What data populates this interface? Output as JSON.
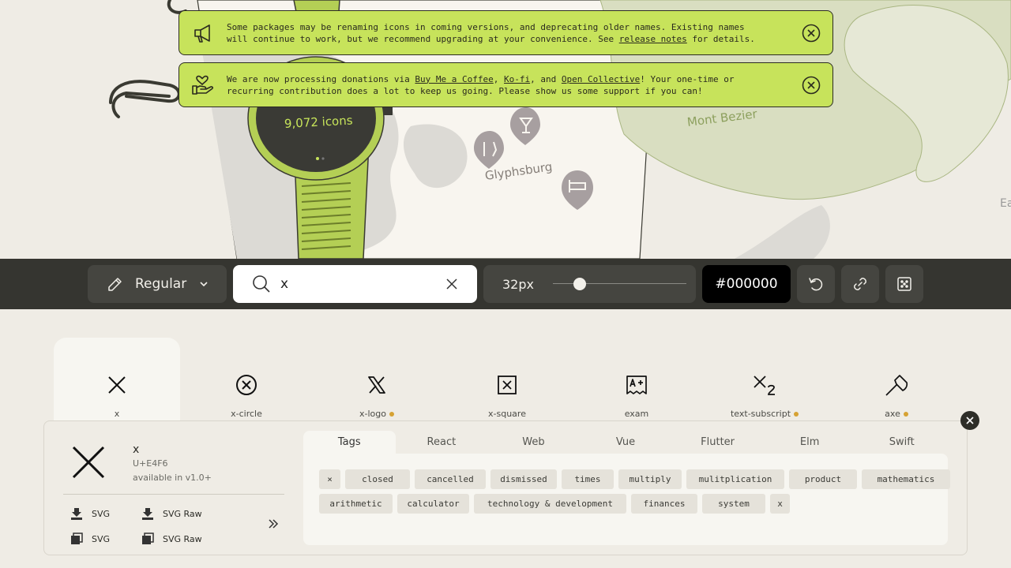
{
  "hero": {
    "watch_count": "9,072 icons",
    "map_labels": {
      "town": "Glyphsburg",
      "mountain": "Mont Bezier",
      "edge": "Ea"
    }
  },
  "notices": [
    {
      "icon": "megaphone-icon",
      "text_before": "Some packages may be renaming icons in coming versions, and deprecating older names. Existing names\nwill continue to work, but we recommend upgrading at your convenience. See ",
      "link": "release notes",
      "text_after": " for details."
    },
    {
      "icon": "hand-heart-icon",
      "text_1": "We are now processing donations via ",
      "link_1": "Buy Me a Coffee",
      "sep_1": ", ",
      "link_2": "Ko-fi",
      "sep_2": ", and ",
      "link_3": "Open Collective",
      "text_2": "! Your one-time or\nrecurring contribution does a lot to keep us going. Please show us some support if you can!"
    }
  ],
  "toolbar": {
    "weight": "Regular",
    "search": {
      "value": "x",
      "placeholder": ""
    },
    "size": {
      "label": "32px",
      "value": 32,
      "min": 16,
      "max": 96
    },
    "color": "#000000"
  },
  "grid": [
    {
      "name": "x",
      "icon": "x-icon",
      "selected": true,
      "badge": false
    },
    {
      "name": "x-circle",
      "icon": "x-circle-icon",
      "selected": false,
      "badge": false
    },
    {
      "name": "x-logo",
      "icon": "x-logo-icon",
      "selected": false,
      "badge": true
    },
    {
      "name": "x-square",
      "icon": "x-square-icon",
      "selected": false,
      "badge": false
    },
    {
      "name": "exam",
      "icon": "exam-icon",
      "selected": false,
      "badge": false
    },
    {
      "name": "text-subscript",
      "icon": "text-subscript-icon",
      "selected": false,
      "badge": true
    },
    {
      "name": "axe",
      "icon": "axe-icon",
      "selected": false,
      "badge": true
    }
  ],
  "detail": {
    "name": "x",
    "code": "U+E4F6",
    "available": "available in v1.0+",
    "actions": [
      "SVG",
      "SVG Raw",
      "SVG",
      "SVG Raw"
    ],
    "tabs": [
      "Tags",
      "React",
      "Web",
      "Vue",
      "Flutter",
      "Elm",
      "Swift"
    ],
    "active_tab": "Tags",
    "tags": [
      "×",
      "closed",
      "cancelled",
      "dismissed",
      "times",
      "multiply",
      "mulitplication",
      "product",
      "mathematics",
      "arithmetic",
      "calculator",
      "technology & development",
      "finances",
      "system",
      "x"
    ]
  },
  "colors": {
    "accent": "#c7e35b",
    "toolbar": "#353530",
    "badge": "#d6a233"
  }
}
